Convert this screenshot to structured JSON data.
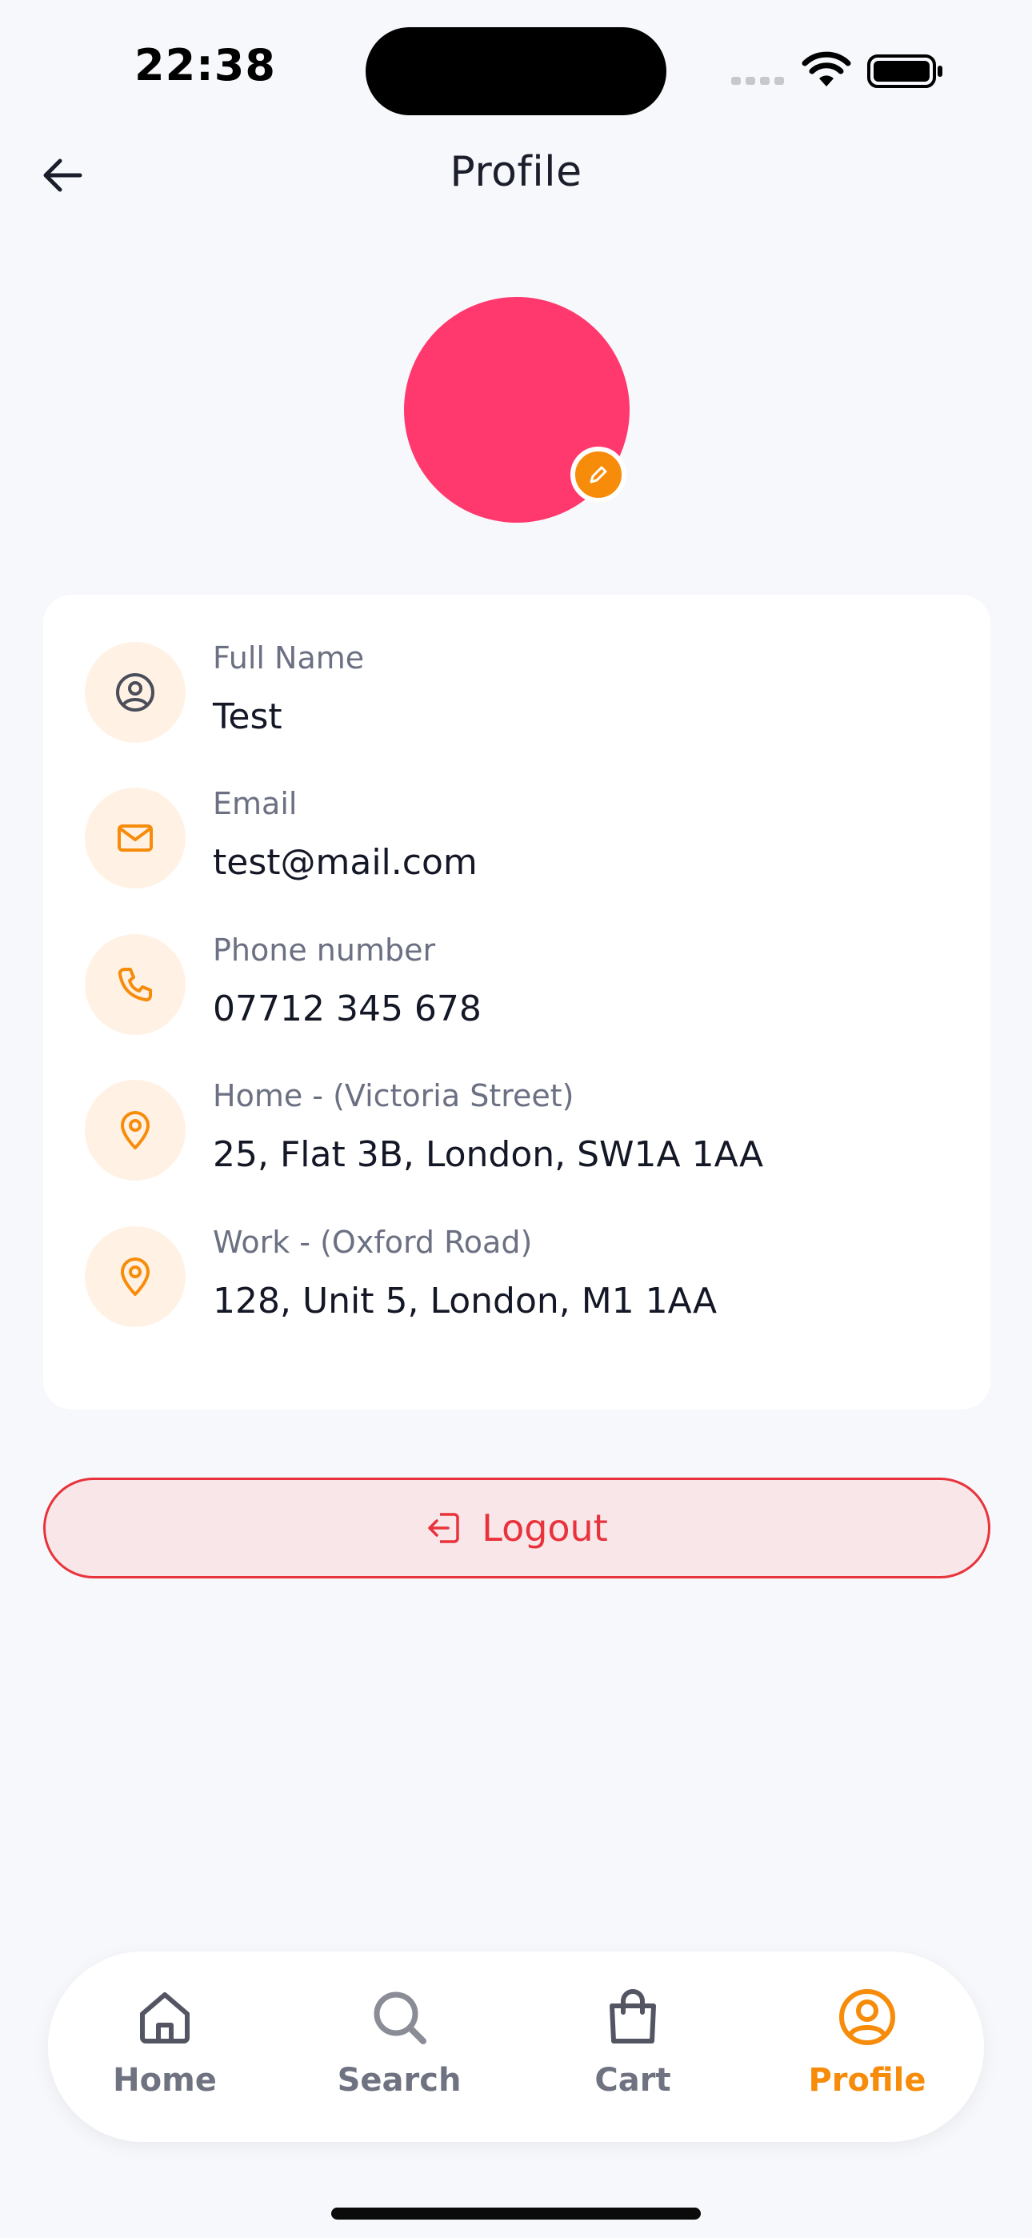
{
  "status_bar": {
    "time": "22:38"
  },
  "header": {
    "title": "Profile"
  },
  "profile_fields": [
    {
      "label": "Full Name",
      "value": "Test",
      "icon": "user-circle-icon"
    },
    {
      "label": "Email",
      "value": "test@mail.com",
      "icon": "mail-icon"
    },
    {
      "label": "Phone number",
      "value": "07712 345 678",
      "icon": "phone-icon"
    },
    {
      "label": "Home - (Victoria Street)",
      "value": "25, Flat 3B, London, SW1A 1AA",
      "icon": "location-pin-icon"
    },
    {
      "label": "Work - (Oxford Road)",
      "value": "128, Unit 5, London, M1 1AA",
      "icon": "location-pin-icon"
    }
  ],
  "logout": {
    "label": "Logout"
  },
  "nav": {
    "items": [
      {
        "label": "Home",
        "icon": "home-icon"
      },
      {
        "label": "Search",
        "icon": "search-icon"
      },
      {
        "label": "Cart",
        "icon": "shopping-bag-icon"
      },
      {
        "label": "Profile",
        "icon": "user-circle-icon",
        "active": true
      }
    ]
  },
  "colors": {
    "accent": "#f78b0a",
    "avatar": "#ff386d",
    "danger": "#e8333c",
    "icon_bg": "#fff2e4",
    "background": "#f7f8fb"
  }
}
